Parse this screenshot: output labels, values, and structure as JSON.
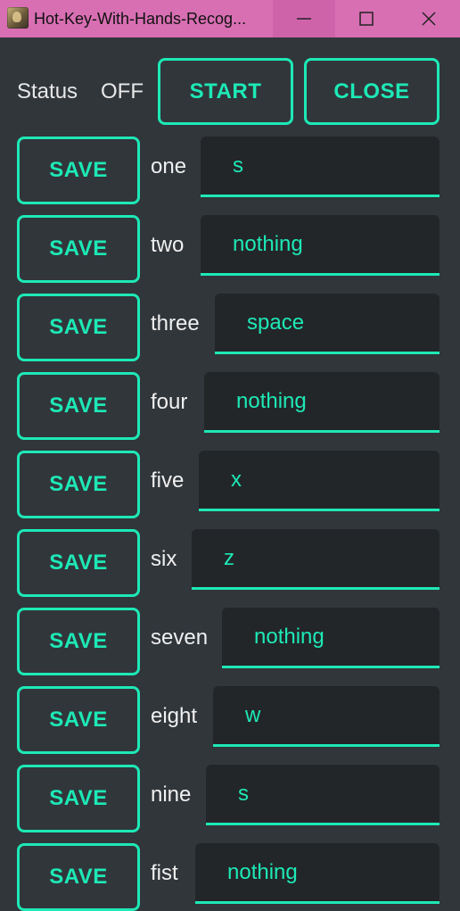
{
  "window": {
    "title": "Hot-Key-With-Hands-Recog..."
  },
  "status": {
    "label": "Status",
    "value": "OFF"
  },
  "buttons": {
    "start": "START",
    "close": "CLOSE"
  },
  "rows": [
    {
      "gesture": "one",
      "save_label": "SAVE",
      "key": "s"
    },
    {
      "gesture": "two",
      "save_label": "SAVE",
      "key": "nothing"
    },
    {
      "gesture": "three",
      "save_label": "SAVE",
      "key": "space"
    },
    {
      "gesture": "four",
      "save_label": "SAVE",
      "key": "nothing"
    },
    {
      "gesture": "five",
      "save_label": "SAVE",
      "key": "x"
    },
    {
      "gesture": "six",
      "save_label": "SAVE",
      "key": "z"
    },
    {
      "gesture": "seven",
      "save_label": "SAVE",
      "key": "nothing"
    },
    {
      "gesture": "eight",
      "save_label": "SAVE",
      "key": "w"
    },
    {
      "gesture": "nine",
      "save_label": "SAVE",
      "key": "s"
    },
    {
      "gesture": "fist",
      "save_label": "SAVE",
      "key": "nothing"
    }
  ],
  "icons": {
    "app": "app-icon",
    "minimize": "minimize-icon",
    "maximize": "maximize-icon",
    "close": "close-icon"
  },
  "colors": {
    "accent": "#1de9b6",
    "background": "#31363b",
    "field_background": "#232629",
    "titlebar": "#d86fb3",
    "text": "#e8e8e8"
  }
}
